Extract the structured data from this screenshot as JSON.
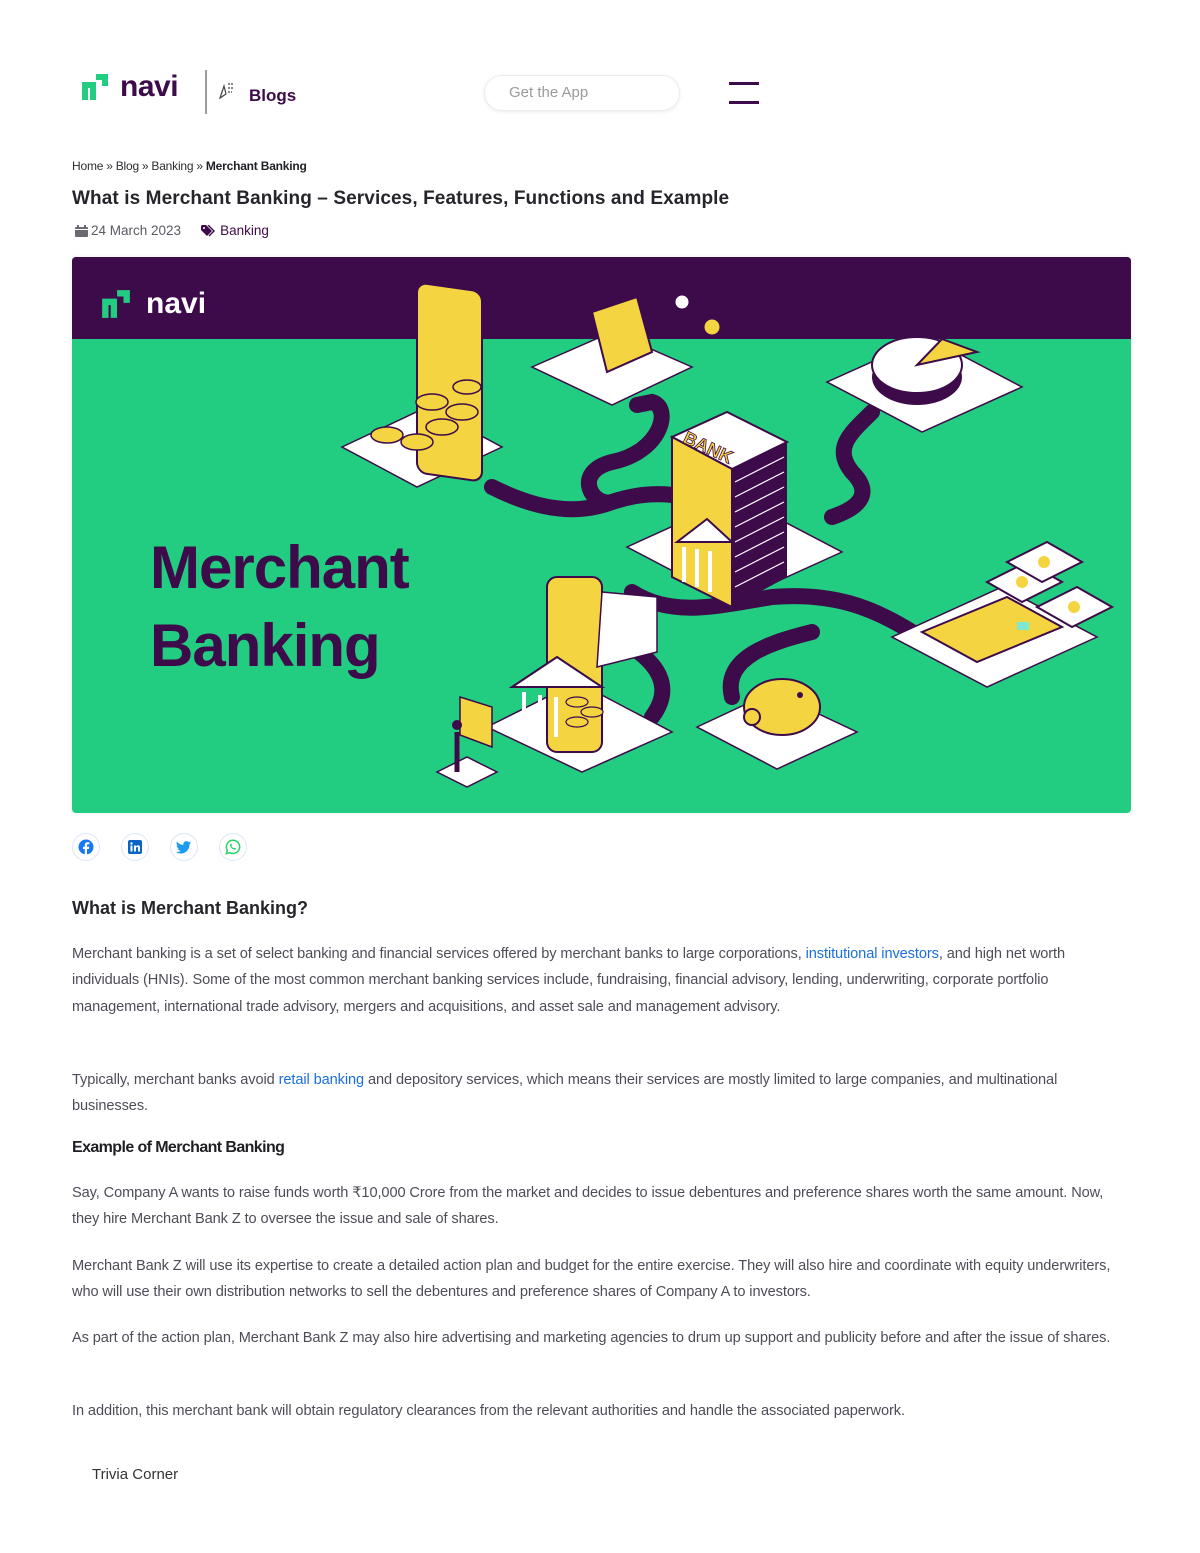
{
  "header": {
    "logo_text": "navi",
    "section_label": "Blogs",
    "get_app_label": "Get the App",
    "menu_icon": "hamburger-menu-icon"
  },
  "breadcrumb": {
    "items": [
      "Home",
      "Blog",
      "Banking"
    ],
    "separator": "»",
    "current": "Merchant Banking"
  },
  "article": {
    "title": "What is Merchant Banking – Services, Features, Functions and Example",
    "date": "24 March 2023",
    "category": "Banking",
    "hero": {
      "logo_text": "navi",
      "title_line1": "Merchant",
      "title_line2": "Banking"
    },
    "share": [
      {
        "network": "facebook",
        "icon": "facebook-icon",
        "color": "#1877f2"
      },
      {
        "network": "linkedin",
        "icon": "linkedin-icon",
        "color": "#0a66c2"
      },
      {
        "network": "twitter",
        "icon": "twitter-icon",
        "color": "#1d9bf0"
      },
      {
        "network": "whatsapp",
        "icon": "whatsapp-icon",
        "color": "#25d366"
      }
    ],
    "section1_heading": "What is Merchant Banking?",
    "p1": {
      "before": "Merchant banking is a set of select banking and financial services offered by merchant banks to large corporations, ",
      "link": "institutional investors",
      "after": ", and high net worth individuals (HNIs). Some of the most common merchant banking services include, fundraising, financial advisory, lending, underwriting, corporate portfolio management, international trade advisory, mergers and acquisitions, and asset sale and management advisory."
    },
    "p2": {
      "before": "Typically, merchant banks avoid ",
      "link": "retail banking",
      "after": " and depository services, which means their services are mostly limited to large companies, and multinational businesses."
    },
    "section2_heading": "Example of Merchant Banking",
    "p3": "Say, Company A wants to raise funds worth ₹10,000 Crore from the market and decides to issue debentures and preference shares worth the same amount. Now, they hire Merchant Bank Z to oversee the issue and sale of shares.",
    "p4": "Merchant Bank Z will use its expertise to create a detailed action plan and budget for the entire exercise. They will also hire and coordinate with equity underwriters, who will use their own distribution networks to sell the debentures and preference shares of Company A to investors.",
    "p5": "As part of the action plan, Merchant Bank Z may also hire advertising and marketing agencies to drum up support and publicity before and after the issue of shares.",
    "p6": "In addition, this merchant bank will obtain regulatory clearances from the relevant authorities and handle the associated paperwork.",
    "trivia_label": "Trivia Corner"
  },
  "colors": {
    "brand_purple": "#3d0a4a",
    "brand_green": "#22cc80",
    "link_blue": "#1a6fe0",
    "accent_yellow": "#f5d442"
  }
}
